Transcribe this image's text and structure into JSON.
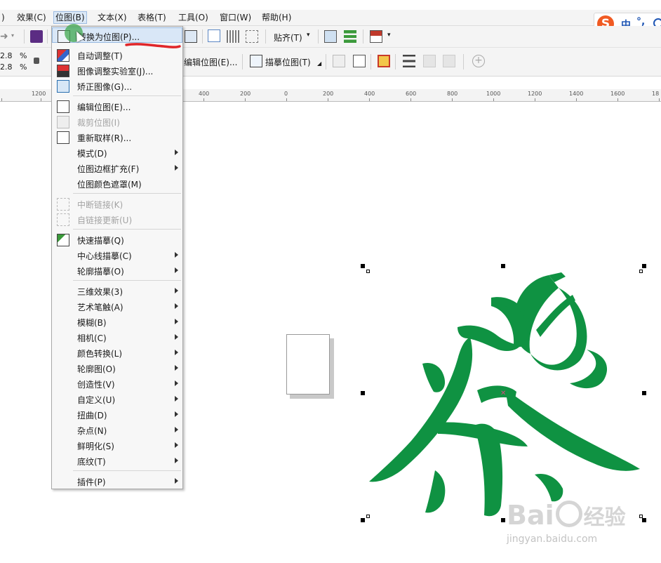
{
  "menubar": {
    "items": [
      {
        "label": ")"
      },
      {
        "label": "效果(C)"
      },
      {
        "label": "位图(B)"
      },
      {
        "label": "文本(X)"
      },
      {
        "label": "表格(T)"
      },
      {
        "label": "工具(O)"
      },
      {
        "label": "窗口(W)"
      },
      {
        "label": "帮助(H)"
      }
    ]
  },
  "ime": {
    "lang": "中",
    "punct": "°,"
  },
  "toolbar1": {
    "snap_label": "贴齐(T)"
  },
  "toolbar2": {
    "scale_x": "2.8",
    "scale_y": "2.8",
    "percent": "%",
    "edit_bitmap_label": "编辑位图(E)...",
    "trace_bitmap_label": "描摹位图(T)"
  },
  "ruler": {
    "labels": [
      "1200",
      "400",
      "200",
      "0",
      "200",
      "400",
      "600",
      "800",
      "1000",
      "1200",
      "1400",
      "1600",
      "18"
    ]
  },
  "menu": {
    "items": [
      {
        "label": "转换为位图(P)...",
        "icon": "convert-to-bitmap-icon"
      },
      {
        "label": "自动调整(T)",
        "icon": "auto-adjust-icon"
      },
      {
        "label": "图像调整实验室(J)...",
        "icon": "image-adjustment-lab-icon"
      },
      {
        "label": "矫正图像(G)...",
        "icon": "straighten-image-icon"
      },
      {
        "label": "编辑位图(E)...",
        "icon": "edit-bitmap-icon"
      },
      {
        "label": "裁剪位图(I)",
        "icon": "crop-bitmap-icon"
      },
      {
        "label": "重新取样(R)...",
        "icon": "resample-icon"
      },
      {
        "label": "模式(D)"
      },
      {
        "label": "位图边框扩充(F)"
      },
      {
        "label": "位图颜色遮罩(M)"
      },
      {
        "label": "中断链接(K)",
        "icon": "break-link-icon"
      },
      {
        "label": "自链接更新(U)",
        "icon": "update-link-icon"
      },
      {
        "label": "快速描摹(Q)",
        "icon": "quick-trace-icon"
      },
      {
        "label": "中心线描摹(C)"
      },
      {
        "label": "轮廓描摹(O)"
      },
      {
        "label": "三维效果(3)"
      },
      {
        "label": "艺术笔触(A)"
      },
      {
        "label": "模糊(B)"
      },
      {
        "label": "相机(C)"
      },
      {
        "label": "颜色转换(L)"
      },
      {
        "label": "轮廓图(O)"
      },
      {
        "label": "创造性(V)"
      },
      {
        "label": "自定义(U)"
      },
      {
        "label": "扭曲(D)"
      },
      {
        "label": "杂点(N)"
      },
      {
        "label": "鲜明化(S)"
      },
      {
        "label": "底纹(T)"
      },
      {
        "label": "插件(P)"
      }
    ]
  },
  "canvas": {
    "glyph": "茶",
    "glyph_color": "#0f9242"
  },
  "watermark": {
    "brand": "Bai",
    "brand2": "经验",
    "url": "jingyan.baidu.com"
  }
}
